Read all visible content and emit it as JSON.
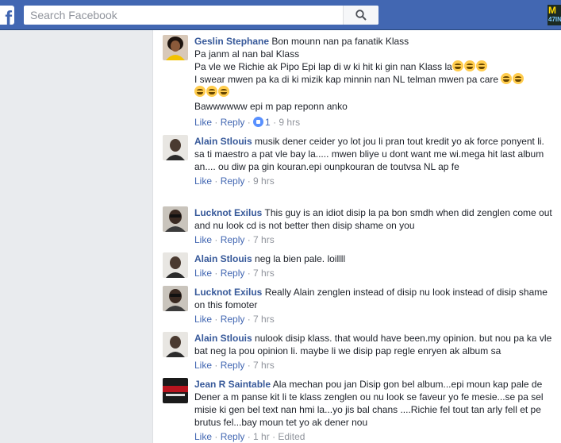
{
  "search": {
    "placeholder": "Search Facebook"
  },
  "header": {
    "corner_badge_top": "M",
    "corner_badge_bottom": "47IN"
  },
  "actions": {
    "like": "Like",
    "reply": "Reply",
    "edited": "Edited"
  },
  "comments": [
    {
      "author": "Geslin Stephane",
      "text_lines": [
        "Bon mounn nan pa fanatik Klass",
        "Pa janm al nan bal Klass",
        "Pa vle we Richie ak Pipo Epi lap di w ki hit ki gin nan Klass la",
        "I swear mwen pa ka di ki mizik kap minnin nan NL telman mwen pa care",
        "",
        "Bawwwwww epi m pap reponn anko"
      ],
      "reaction_count": "1",
      "time": "9 hrs"
    },
    {
      "author": "Alain Stlouis",
      "text": "musik dener ceider yo lot jou li pran tout kredit yo ak force ponyent li. sa ti maestro a pat vle bay la..... mwen bliye u dont want me wi.mega hit last album an.... ou diw pa gin kouran.epi ounpkouran de toutvsa NL ap fe",
      "time": "9 hrs"
    },
    {
      "author": "Lucknot Exilus",
      "text": "This guy is an idiot disip la pa bon smdh when did zenglen come out and nu look cd is not better then disip shame on you",
      "time": "7 hrs"
    },
    {
      "author": "Alain Stlouis",
      "text": "neg la bien pale. loillll",
      "time": "7 hrs"
    },
    {
      "author": "Lucknot Exilus",
      "text": "Really Alain zenglen instead of disip nu look instead of disip shame on this fomoter",
      "time": "7 hrs"
    },
    {
      "author": "Alain Stlouis",
      "text": "nulook disip klass. that would have been.my opinion. but nou pa ka vle bat neg la pou opinion li. maybe li we disip pap regle enryen ak album sa",
      "time": "7 hrs"
    },
    {
      "author": "Jean R Saintable",
      "text": "Ala mechan pou jan Disip gon bel album...epi moun kap pale de Dener a m panse kit li te klass zenglen ou nu look se faveur yo fe mesie...se pa sel misie ki gen bel text nan hmi la...yo jis bal chans ....Richie fel tout tan arly fell et pe brutus fel...bay moun tet yo ak dener nou",
      "time": "1 hr"
    }
  ]
}
